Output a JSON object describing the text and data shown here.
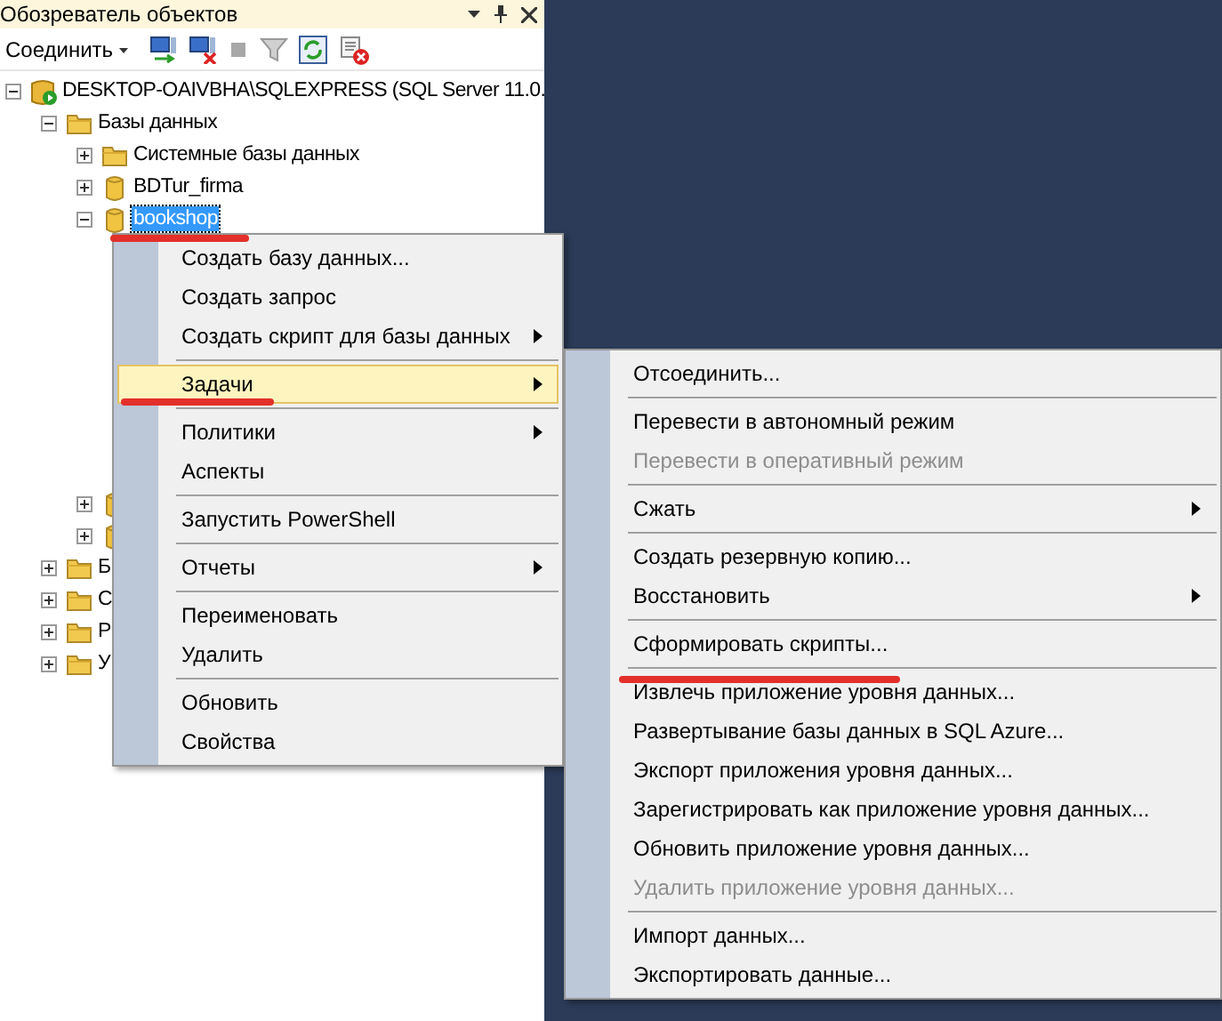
{
  "panel": {
    "title": "Обозреватель объектов",
    "connect_label": "Соединить"
  },
  "tree": [
    {
      "kind": "server",
      "label": "DESKTOP-OAIVBHA\\SQLEXPRESS (SQL Server 11.0.",
      "expanded": true,
      "selected": false,
      "children": [
        {
          "kind": "folder",
          "label": "Базы данных",
          "expanded": true,
          "selected": false,
          "children": [
            {
              "kind": "folder",
              "label": "Системные базы данных",
              "expanded": false,
              "selected": false
            },
            {
              "kind": "database",
              "label": "BDTur_firma",
              "expanded": false,
              "selected": false
            },
            {
              "kind": "database",
              "label": "bookshop",
              "expanded": true,
              "selected": true
            },
            {
              "kind": "database",
              "expanded": false,
              "selected": false
            },
            {
              "kind": "database",
              "expanded": false,
              "selected": false
            }
          ]
        },
        {
          "kind": "folder",
          "label": "Б",
          "expanded": false,
          "selected": false
        },
        {
          "kind": "folder",
          "label": "С",
          "expanded": false,
          "selected": false
        },
        {
          "kind": "folder",
          "label": "Р",
          "expanded": false,
          "selected": false
        },
        {
          "kind": "folder",
          "label": "У",
          "expanded": false,
          "selected": false
        }
      ]
    }
  ],
  "context_menu": {
    "items": [
      {
        "kind": "item",
        "label": "Создать базу данных...",
        "submenu": false,
        "highlighted": false,
        "disabled": false
      },
      {
        "kind": "item",
        "label": "Создать запрос",
        "submenu": false,
        "highlighted": false,
        "disabled": false
      },
      {
        "kind": "item",
        "label": "Создать скрипт для базы данных",
        "submenu": true,
        "highlighted": false,
        "disabled": false
      },
      {
        "kind": "separator"
      },
      {
        "kind": "item",
        "label": "Задачи",
        "submenu": true,
        "highlighted": true,
        "disabled": false
      },
      {
        "kind": "separator"
      },
      {
        "kind": "item",
        "label": "Политики",
        "submenu": true,
        "highlighted": false,
        "disabled": false
      },
      {
        "kind": "item",
        "label": "Аспекты",
        "submenu": false,
        "highlighted": false,
        "disabled": false
      },
      {
        "kind": "separator"
      },
      {
        "kind": "item",
        "label": "Запустить PowerShell",
        "submenu": false,
        "highlighted": false,
        "disabled": false
      },
      {
        "kind": "separator"
      },
      {
        "kind": "item",
        "label": "Отчеты",
        "submenu": true,
        "highlighted": false,
        "disabled": false
      },
      {
        "kind": "separator"
      },
      {
        "kind": "item",
        "label": "Переименовать",
        "submenu": false,
        "highlighted": false,
        "disabled": false
      },
      {
        "kind": "item",
        "label": "Удалить",
        "submenu": false,
        "highlighted": false,
        "disabled": false
      },
      {
        "kind": "separator"
      },
      {
        "kind": "item",
        "label": "Обновить",
        "submenu": false,
        "highlighted": false,
        "disabled": false
      },
      {
        "kind": "item",
        "label": "Свойства",
        "submenu": false,
        "highlighted": false,
        "disabled": false
      }
    ]
  },
  "submenu": {
    "items": [
      {
        "kind": "item",
        "label": "Отсоединить...",
        "submenu": false,
        "highlighted": false,
        "disabled": false
      },
      {
        "kind": "separator"
      },
      {
        "kind": "item",
        "label": "Перевести в автономный режим",
        "submenu": false,
        "highlighted": false,
        "disabled": false
      },
      {
        "kind": "item",
        "label": "Перевести в оперативный режим",
        "submenu": false,
        "highlighted": false,
        "disabled": true
      },
      {
        "kind": "separator"
      },
      {
        "kind": "item",
        "label": "Сжать",
        "submenu": true,
        "highlighted": false,
        "disabled": false
      },
      {
        "kind": "separator"
      },
      {
        "kind": "item",
        "label": "Создать резервную копию...",
        "submenu": false,
        "highlighted": false,
        "disabled": false
      },
      {
        "kind": "item",
        "label": "Восстановить",
        "submenu": true,
        "highlighted": false,
        "disabled": false
      },
      {
        "kind": "separator"
      },
      {
        "kind": "item",
        "label": "Сформировать скрипты...",
        "submenu": false,
        "highlighted": false,
        "disabled": false
      },
      {
        "kind": "separator"
      },
      {
        "kind": "item",
        "label": "Извлечь приложение уровня данных...",
        "submenu": false,
        "highlighted": false,
        "disabled": false
      },
      {
        "kind": "item",
        "label": "Развертывание базы данных в SQL Azure...",
        "submenu": false,
        "highlighted": false,
        "disabled": false
      },
      {
        "kind": "item",
        "label": "Экспорт приложения уровня данных...",
        "submenu": false,
        "highlighted": false,
        "disabled": false
      },
      {
        "kind": "item",
        "label": "Зарегистрировать как приложение уровня данных...",
        "submenu": false,
        "highlighted": false,
        "disabled": false
      },
      {
        "kind": "item",
        "label": "Обновить приложение уровня данных...",
        "submenu": false,
        "highlighted": false,
        "disabled": false
      },
      {
        "kind": "item",
        "label": "Удалить приложение уровня данных...",
        "submenu": false,
        "highlighted": false,
        "disabled": true
      },
      {
        "kind": "separator"
      },
      {
        "kind": "item",
        "label": "Импорт данных...",
        "submenu": false,
        "highlighted": false,
        "disabled": false
      },
      {
        "kind": "item",
        "label": "Экспортировать данные...",
        "submenu": false,
        "highlighted": false,
        "disabled": false
      }
    ]
  }
}
